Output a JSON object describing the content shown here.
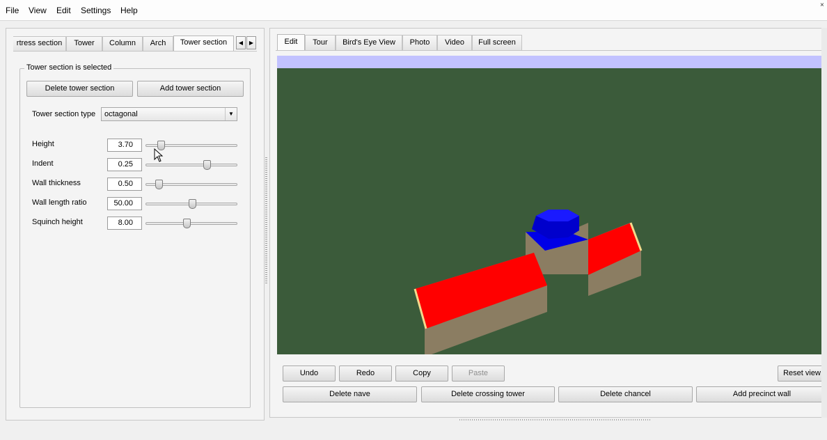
{
  "menu": [
    "File",
    "View",
    "Edit",
    "Settings",
    "Help"
  ],
  "left_tabs": {
    "items": [
      "rtress section",
      "Tower",
      "Column",
      "Arch",
      "Tower section"
    ],
    "active": "Tower section",
    "prev_icon": "left-arrow-icon",
    "next_icon": "right-arrow-icon"
  },
  "group": {
    "title": "Tower section is selected",
    "delete_button": "Delete tower section",
    "add_button": "Add tower section",
    "type_label": "Tower section type",
    "type_value": "octagonal"
  },
  "params": [
    {
      "label": "Height",
      "value": "3.70",
      "fraction": 0.13
    },
    {
      "label": "Indent",
      "value": "0.25",
      "fraction": 0.68
    },
    {
      "label": "Wall thickness",
      "value": "0.50",
      "fraction": 0.11
    },
    {
      "label": "Wall length ratio",
      "value": "50.00",
      "fraction": 0.5
    },
    {
      "label": "Squinch height",
      "value": "8.00",
      "fraction": 0.44
    }
  ],
  "view_tabs": {
    "items": [
      "Edit",
      "Tour",
      "Bird's Eye View",
      "Photo",
      "Video",
      "Full screen"
    ],
    "active": "Edit"
  },
  "actions_row1": {
    "undo": "Undo",
    "redo": "Redo",
    "copy": "Copy",
    "paste": "Paste",
    "reset_view": "Reset view"
  },
  "actions_row2": {
    "delete_nave": "Delete nave",
    "delete_crossing_tower": "Delete crossing tower",
    "delete_chancel": "Delete chancel",
    "add_precinct_wall": "Add precinct wall"
  },
  "colors": {
    "viewport_bg": "#3b5b3a",
    "viewport_top": "#c2c2ff",
    "roof": "#ff0000",
    "wall": "#8b7d62",
    "tower": "#0000d8"
  }
}
